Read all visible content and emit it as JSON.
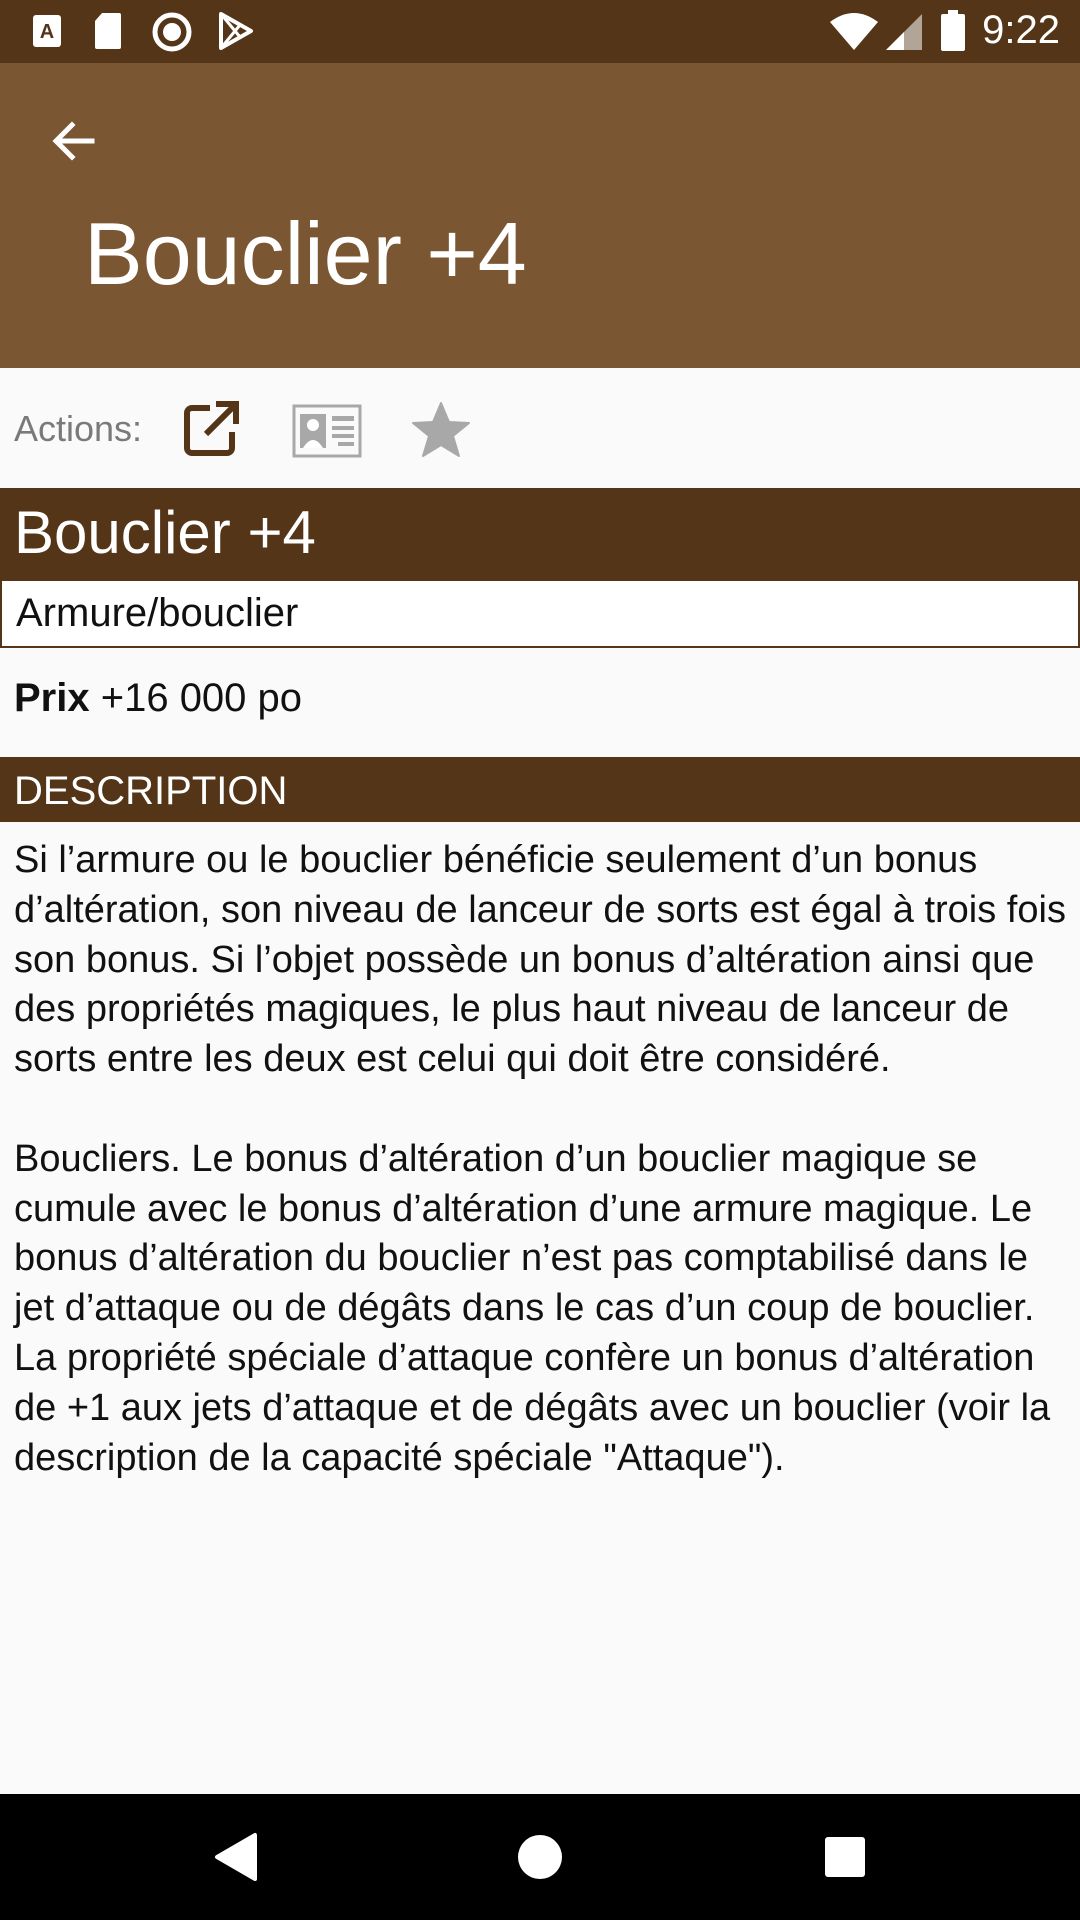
{
  "status_bar": {
    "time": "9:22",
    "icons": [
      "text-a-icon",
      "sd-card-icon",
      "record-icon",
      "play-store-icon",
      "wifi-icon",
      "signal-icon",
      "battery-icon"
    ]
  },
  "app_bar": {
    "back_icon": "arrow-left-icon",
    "title": "Bouclier +4"
  },
  "actions": {
    "label": "Actions:",
    "buttons": [
      "open-external-icon",
      "id-card-icon",
      "star-icon"
    ]
  },
  "item": {
    "name": "Bouclier +4",
    "type": "Armure/bouclier",
    "price_label": "Prix",
    "price_value": " +16 000 po"
  },
  "description": {
    "header": "DESCRIPTION",
    "paragraphs": [
      "Si l’armure ou le bouclier bénéficie seulement d’un bonus d’altération, son niveau de lanceur de sorts est égal à trois fois son bonus. Si l’objet possède un bonus d’altération ainsi que des propriétés magiques, le plus haut niveau de lanceur de sorts entre les deux est celui qui doit être considéré.",
      "Boucliers. Le bonus d’altération d’un bouclier magique se cumule avec le bonus d’altération d’une armure magique. Le bonus d’altération du bouclier n’est pas comptabilisé dans le jet d’attaque ou de dégâts dans le cas d’un coup de bouclier. La propriété spéciale d’attaque confère un bonus d’altération de +1 aux jets d’attaque et de dégâts avec un bouclier (voir la description de la capacité spéciale \"Attaque\")."
    ]
  },
  "nav_bar": {
    "buttons": [
      "back-triangle-icon",
      "home-circle-icon",
      "recents-square-icon"
    ]
  },
  "colors": {
    "status_bar": "#553517",
    "app_bar": "#7b5632",
    "accent_dark": "#553517",
    "background": "#fafafa"
  }
}
